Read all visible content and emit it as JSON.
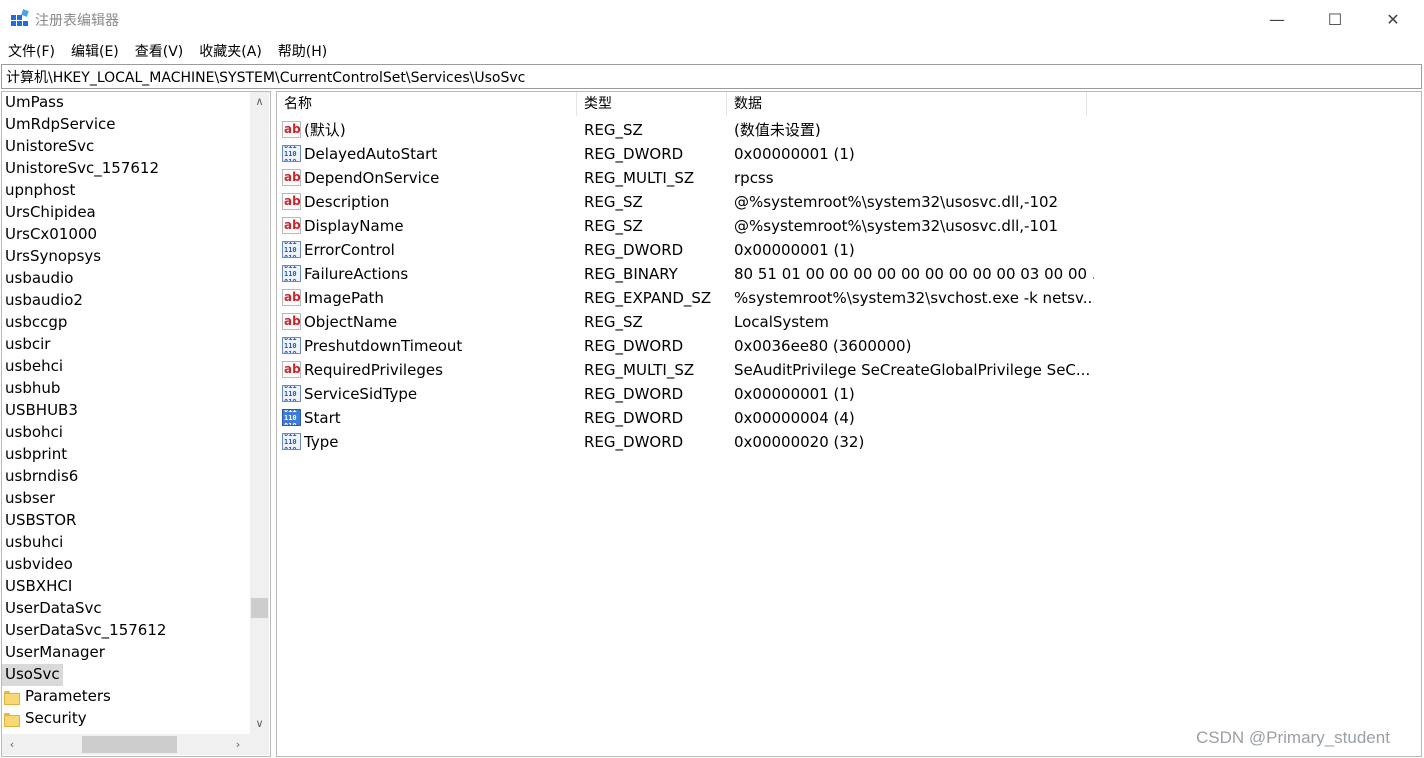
{
  "window": {
    "title": "注册表编辑器",
    "controls": {
      "minimize": "—",
      "maximize": "☐",
      "close": "✕"
    }
  },
  "menu": [
    "文件(F)",
    "编辑(E)",
    "查看(V)",
    "收藏夹(A)",
    "帮助(H)"
  ],
  "address": "计算机\\HKEY_LOCAL_MACHINE\\SYSTEM\\CurrentControlSet\\Services\\UsoSvc",
  "tree": {
    "items": [
      "UmPass",
      "UmRdpService",
      "UnistoreSvc",
      "UnistoreSvc_157612",
      "upnphost",
      "UrsChipidea",
      "UrsCx01000",
      "UrsSynopsys",
      "usbaudio",
      "usbaudio2",
      "usbccgp",
      "usbcir",
      "usbehci",
      "usbhub",
      "USBHUB3",
      "usbohci",
      "usbprint",
      "usbrndis6",
      "usbser",
      "USBSTOR",
      "usbuhci",
      "usbvideo",
      "USBXHCI",
      "UserDataSvc",
      "UserDataSvc_157612",
      "UserManager"
    ],
    "selected": "UsoSvc",
    "children": [
      "Parameters",
      "Security"
    ]
  },
  "columns": {
    "name": "名称",
    "type": "类型",
    "data": "数据"
  },
  "values": [
    {
      "icon": "string-value-icon",
      "name": "(默认)",
      "type": "REG_SZ",
      "data": "(数值未设置)"
    },
    {
      "icon": "binary-value-icon",
      "name": "DelayedAutoStart",
      "type": "REG_DWORD",
      "data": "0x00000001 (1)"
    },
    {
      "icon": "string-value-icon",
      "name": "DependOnService",
      "type": "REG_MULTI_SZ",
      "data": "rpcss"
    },
    {
      "icon": "string-value-icon",
      "name": "Description",
      "type": "REG_SZ",
      "data": "@%systemroot%\\system32\\usosvc.dll,-102"
    },
    {
      "icon": "string-value-icon",
      "name": "DisplayName",
      "type": "REG_SZ",
      "data": "@%systemroot%\\system32\\usosvc.dll,-101"
    },
    {
      "icon": "binary-value-icon",
      "name": "ErrorControl",
      "type": "REG_DWORD",
      "data": "0x00000001 (1)"
    },
    {
      "icon": "binary-value-icon",
      "name": "FailureActions",
      "type": "REG_BINARY",
      "data": "80 51 01 00 00 00 00 00 00 00 00 00 03 00 00 ..."
    },
    {
      "icon": "string-value-icon",
      "name": "ImagePath",
      "type": "REG_EXPAND_SZ",
      "data": "%systemroot%\\system32\\svchost.exe -k netsv..."
    },
    {
      "icon": "string-value-icon",
      "name": "ObjectName",
      "type": "REG_SZ",
      "data": "LocalSystem"
    },
    {
      "icon": "binary-value-icon",
      "name": "PreshutdownTimeout",
      "type": "REG_DWORD",
      "data": "0x0036ee80 (3600000)"
    },
    {
      "icon": "string-value-icon",
      "name": "RequiredPrivileges",
      "type": "REG_MULTI_SZ",
      "data": "SeAuditPrivilege SeCreateGlobalPrivilege SeC..."
    },
    {
      "icon": "binary-value-icon",
      "name": "ServiceSidType",
      "type": "REG_DWORD",
      "data": "0x00000001 (1)"
    },
    {
      "icon": "binary-value-icon",
      "name": "Start",
      "type": "REG_DWORD",
      "data": "0x00000004 (4)"
    },
    {
      "icon": "binary-value-icon",
      "name": "Type",
      "type": "REG_DWORD",
      "data": "0x00000020 (32)"
    }
  ],
  "icons": {
    "string_glyph": "ab",
    "binary_glyph": "011\n110\n010"
  },
  "watermark": "CSDN @Primary_student",
  "colors": {
    "selection": "#d9d9d9",
    "string_icon": "#c8282d",
    "binary_icon": "#2a5bb0",
    "folder": "#f8d775"
  }
}
